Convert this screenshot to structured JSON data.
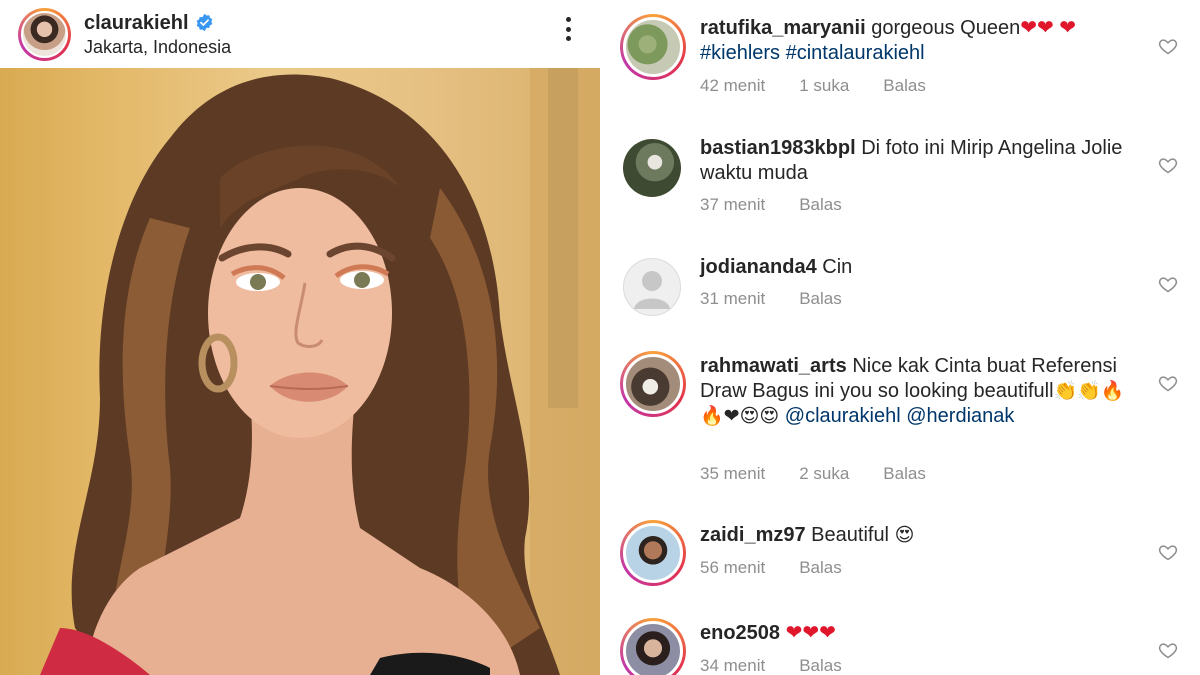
{
  "post": {
    "username": "claurakiehl",
    "location": "Jakarta, Indonesia",
    "verified": true,
    "photo_alt": "portrait photo"
  },
  "comments": [
    {
      "username": "ratufika_maryanii",
      "text": "gorgeous Queen",
      "text_suffix": "❤❤ ❤",
      "hashtags": "#kiehlers #cintalaurakiehl",
      "time": "42 menit",
      "likes": "1 suka",
      "reply": "Balas"
    },
    {
      "username": "bastian1983kbpl",
      "text": "Di foto ini Mirip Angelina Jolie waktu muda",
      "time": "37 menit",
      "reply": "Balas"
    },
    {
      "username": "jodiananda4",
      "text": "Cin",
      "time": "31 menit",
      "reply": "Balas"
    },
    {
      "username": "rahmawati_arts",
      "text": "Nice kak Cinta buat Referensi Draw Bagus ini you so looking beautifull",
      "emoji": "👏👏🔥🔥❤😍😍",
      "mention1": "@claurakiehl",
      "mention2": "@herdianak",
      "time": "35 menit",
      "likes": "2 suka",
      "reply": "Balas"
    },
    {
      "username": "zaidi_mz97",
      "text": "Beautiful",
      "emoji": "😍",
      "time": "56 menit",
      "reply": "Balas"
    },
    {
      "username": "eno2508",
      "emoji": "❤❤❤",
      "time": "34 menit",
      "reply": "Balas"
    }
  ],
  "colors": {
    "accent_link": "#00376b",
    "verified": "#3897f0",
    "meta": "#8e8e8e",
    "heart": "#e0162b"
  },
  "icons": [
    "verified-badge-icon",
    "more-options-icon",
    "heart-outline-icon"
  ]
}
